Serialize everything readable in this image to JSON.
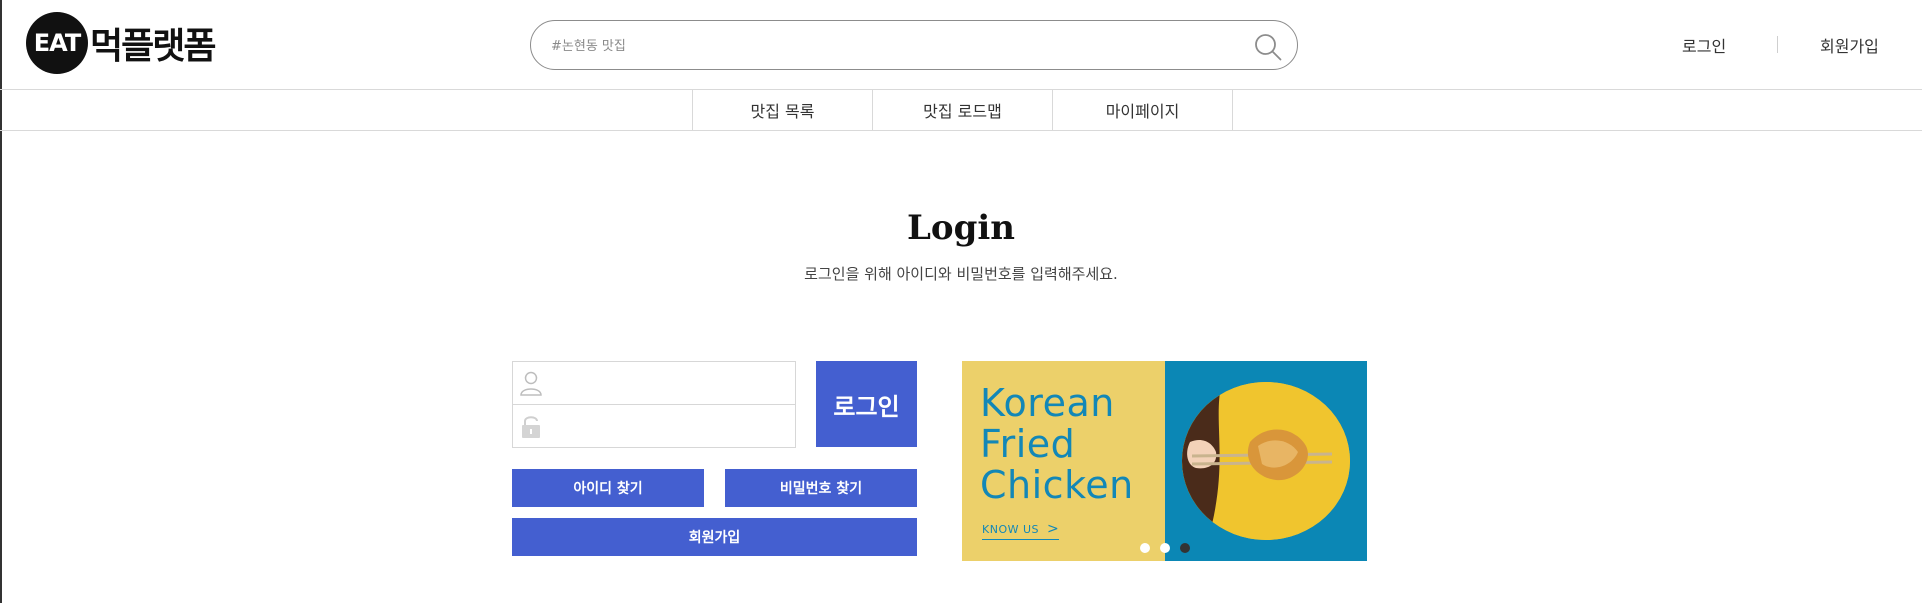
{
  "header": {
    "logo": {
      "badge": "EAT",
      "name": "먹플랫폼"
    },
    "search": {
      "placeholder": "#논현동 맛집"
    },
    "auth": {
      "login": "로그인",
      "signup": "회원가입"
    }
  },
  "nav": {
    "items": [
      {
        "label": "맛집 목록"
      },
      {
        "label": "맛집 로드맵"
      },
      {
        "label": "마이페이지"
      }
    ]
  },
  "page": {
    "title": "Login",
    "subtitle": "로그인을 위해 아이디와 비밀번호를 입력해주세요."
  },
  "form": {
    "login_button": "로그인",
    "find_id": "아이디 찾기",
    "find_password": "비밀번호 찾기",
    "join": "회원가입"
  },
  "banner": {
    "line1": "Korean",
    "line2": "Fried",
    "line3": "Chicken",
    "cta": "KNOW US",
    "slide_count": 3,
    "active_slide": 3
  },
  "colors": {
    "accent": "#445fd0",
    "banner_yellow": "#ecd06a",
    "banner_blue": "#0b87b5"
  },
  "icons": [
    "search-icon",
    "user-icon",
    "lock-icon",
    "chevron-right-icon"
  ]
}
